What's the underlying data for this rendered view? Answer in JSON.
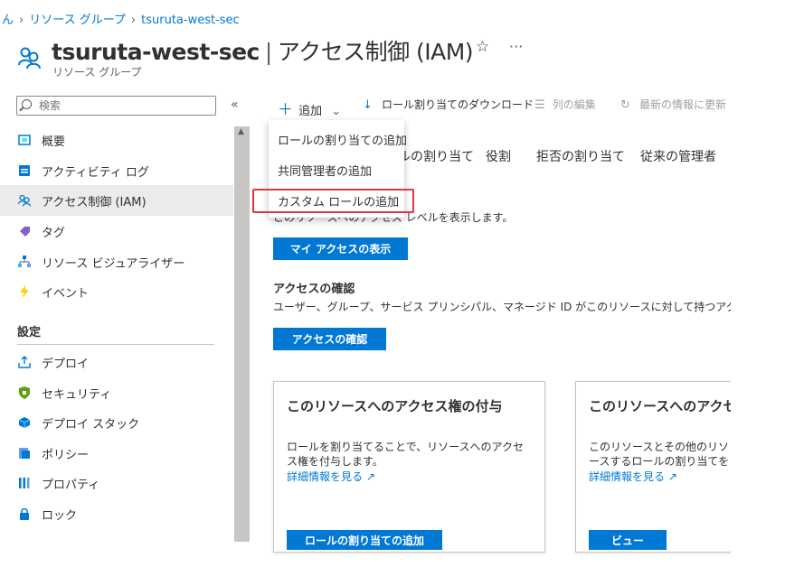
{
  "breadcrumb": {
    "prefix": "ん",
    "items": [
      "リソース グループ",
      "tsuruta-west-sec"
    ]
  },
  "header": {
    "title": "tsuruta-west-sec",
    "separator": "|",
    "section": "アクセス制御 (IAM)",
    "subtitle": "リソース グループ",
    "star": "☆",
    "more": "···"
  },
  "sidebar": {
    "search_placeholder": "検索",
    "collapse": "«",
    "items": [
      {
        "label": "概要",
        "icon": "overview-icon"
      },
      {
        "label": "アクティビティ ログ",
        "icon": "activity-log-icon"
      },
      {
        "label": "アクセス制御 (IAM)",
        "icon": "iam-icon"
      },
      {
        "label": "タグ",
        "icon": "tag-icon"
      },
      {
        "label": "リソース ビジュアライザー",
        "icon": "visualizer-icon"
      },
      {
        "label": "イベント",
        "icon": "events-icon"
      }
    ],
    "settings_header": "設定",
    "settings_items": [
      {
        "label": "デプロイ",
        "icon": "deploy-icon"
      },
      {
        "label": "セキュリティ",
        "icon": "security-icon"
      },
      {
        "label": "デプロイ スタック",
        "icon": "deploy-stack-icon"
      },
      {
        "label": "ポリシー",
        "icon": "policy-icon"
      },
      {
        "label": "プロパティ",
        "icon": "properties-icon"
      },
      {
        "label": "ロック",
        "icon": "lock-icon"
      }
    ]
  },
  "toolbar": {
    "add": "追加",
    "download": "ロール割り当てのダウンロード",
    "edit_columns": "列の編集",
    "refresh": "最新の情報に更新"
  },
  "dropdown": {
    "items": [
      "ロールの割り当ての追加",
      "共同管理者の追加",
      "カスタム ロールの追加"
    ],
    "highlighted_index": 2,
    "highlight_color": "#e0383e"
  },
  "tabs": [
    "ルの割り当て",
    "役割",
    "拒否の割り当て",
    "従来の管理者"
  ],
  "main": {
    "my_access_desc": "このリソースへのアクセス レベルを表示します。",
    "my_access_button": "マイ アクセスの表示",
    "check_access_title": "アクセスの確認",
    "check_access_desc": "ユーザー、グループ、サービス プリンシパル、マネージド ID がこのリソースに対して持つアクセス レ",
    "check_access_button": "アクセスの確認"
  },
  "cards": [
    {
      "title": "このリソースへのアクセス権の付与",
      "desc": "ロールを割り当てることで、リソースへのアクセス権を付与します。",
      "link": "詳細情報を見る",
      "button": "ロールの割り当ての追加"
    },
    {
      "title": "このリソースへのアクセス",
      "desc": "このリソースとその他のリソースするロールの割り当てを表示し",
      "link": "詳細情報を見る",
      "button": "ビュー"
    }
  ],
  "colors": {
    "accent": "#0078d4",
    "active_nav": "#edebe9"
  }
}
